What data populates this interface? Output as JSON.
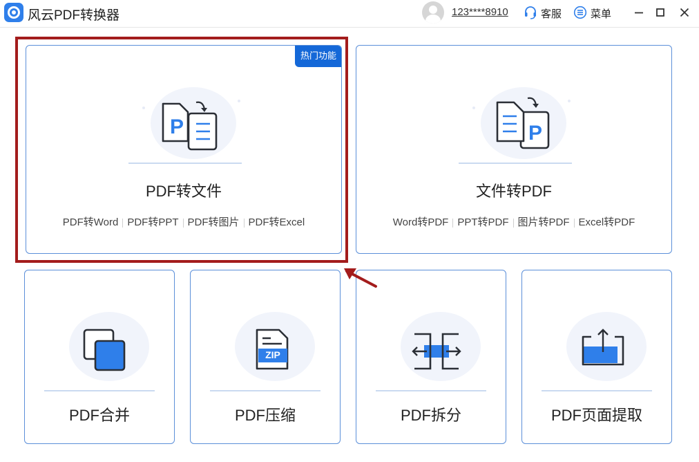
{
  "app": {
    "title": "风云PDF转换器"
  },
  "header": {
    "account": "123****8910",
    "customer_service": "客服",
    "menu": "菜单"
  },
  "cards": {
    "pdf_to_file": {
      "badge": "热门功能",
      "title": "PDF转文件",
      "links": [
        "PDF转Word",
        "PDF转PPT",
        "PDF转图片",
        "PDF转Excel"
      ]
    },
    "file_to_pdf": {
      "title": "文件转PDF",
      "links": [
        "Word转PDF",
        "PPT转PDF",
        "图片转PDF",
        "Excel转PDF"
      ]
    },
    "merge": {
      "title": "PDF合并"
    },
    "compress": {
      "title": "PDF压缩",
      "icon_text": "ZIP"
    },
    "split": {
      "title": "PDF拆分"
    },
    "extract": {
      "title": "PDF页面提取"
    }
  },
  "colors": {
    "accent": "#1468d8",
    "card_border": "#5b8fd9",
    "highlight": "#a31c1c",
    "icon_blue": "#2f7fea",
    "icon_dark": "#2b2f36"
  }
}
